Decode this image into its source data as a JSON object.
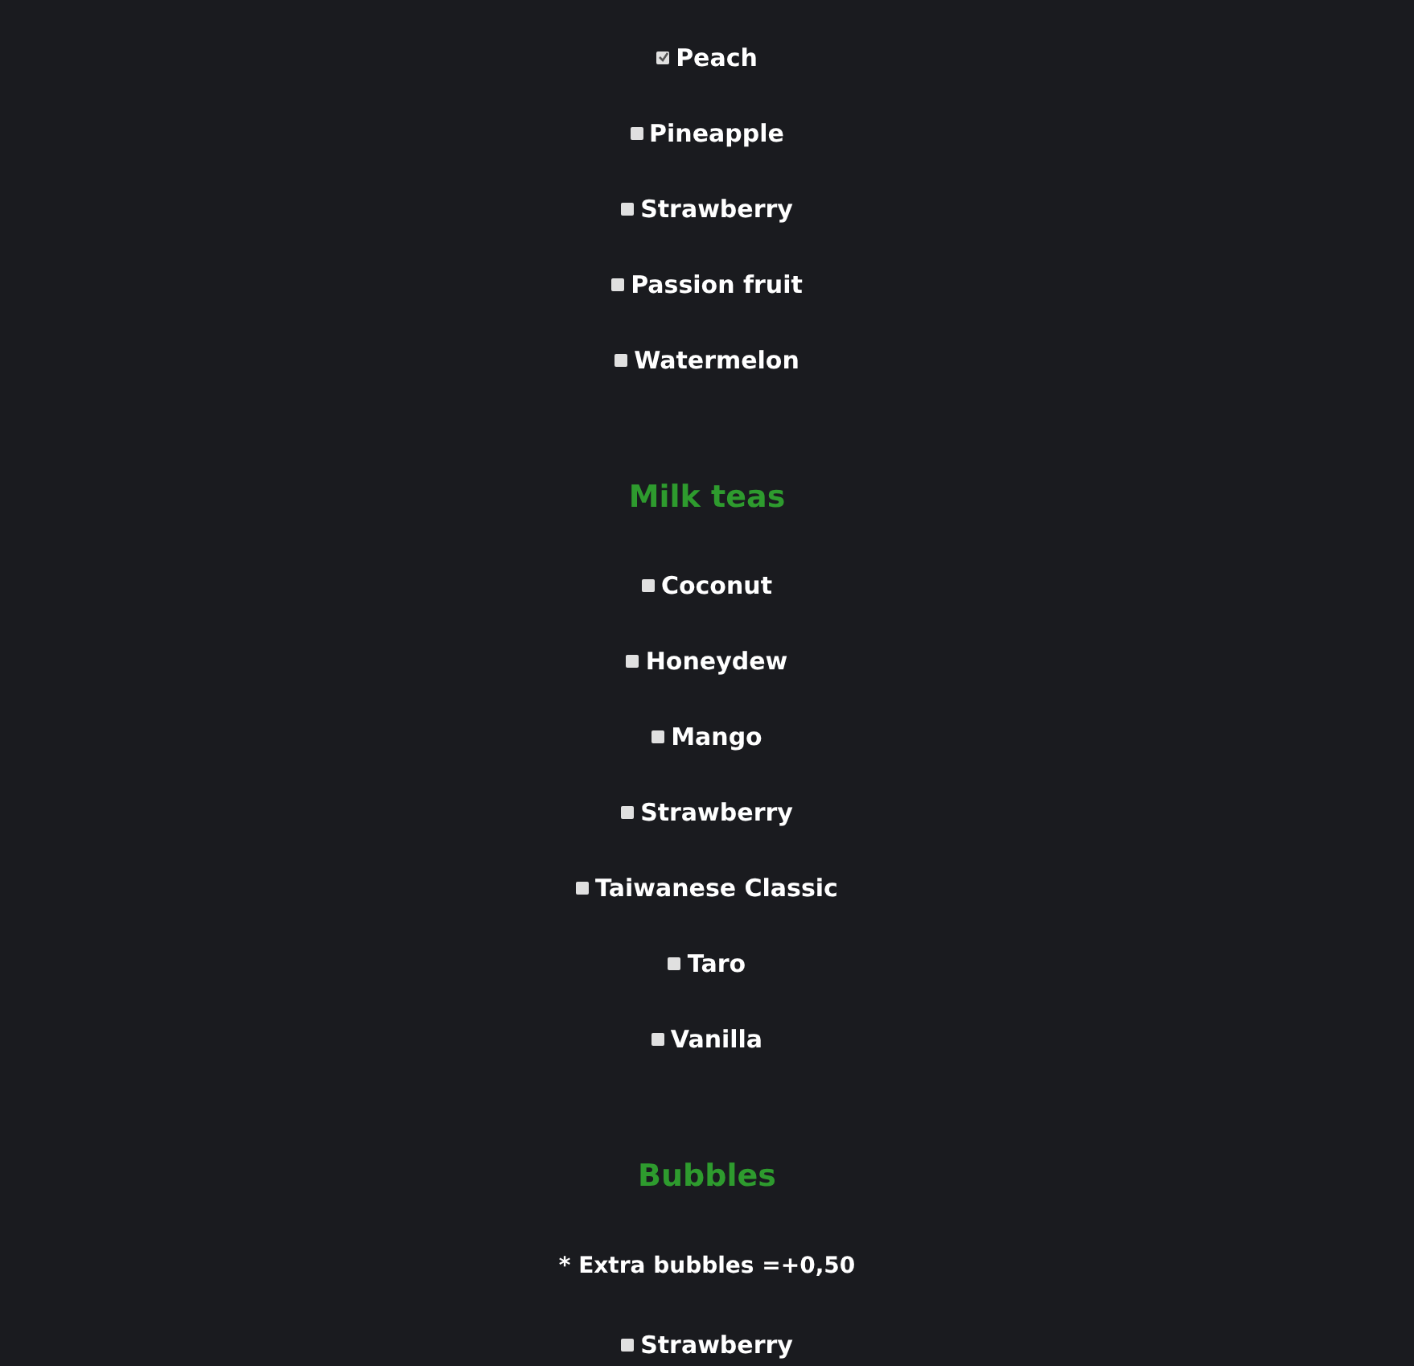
{
  "sections": [
    {
      "items": [
        {
          "label": "Peach",
          "checked": true
        },
        {
          "label": "Pineapple",
          "checked": false
        },
        {
          "label": "Strawberry",
          "checked": false
        },
        {
          "label": "Passion fruit",
          "checked": false
        },
        {
          "label": "Watermelon",
          "checked": false
        }
      ]
    },
    {
      "heading": "Milk teas",
      "items": [
        {
          "label": "Coconut",
          "checked": false
        },
        {
          "label": "Honeydew",
          "checked": false
        },
        {
          "label": "Mango",
          "checked": false
        },
        {
          "label": "Strawberry",
          "checked": false
        },
        {
          "label": "Taiwanese Classic",
          "checked": false
        },
        {
          "label": "Taro",
          "checked": false
        },
        {
          "label": "Vanilla",
          "checked": false
        }
      ]
    },
    {
      "heading": "Bubbles",
      "note": "* Extra bubbles =+0,50",
      "items": [
        {
          "label": "Strawberry",
          "checked": false
        }
      ]
    }
  ]
}
